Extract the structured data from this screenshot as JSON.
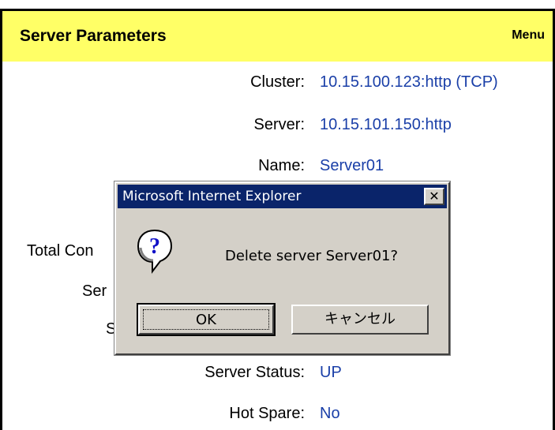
{
  "header": {
    "title": "Server Parameters",
    "menu_label": "Menu"
  },
  "fields": {
    "cluster": {
      "label": "Cluster:",
      "value": "10.15.100.123:http (TCP)"
    },
    "server": {
      "label": "Server:",
      "value": "10.15.101.150:http"
    },
    "name": {
      "label": "Name:",
      "value": "Server01"
    },
    "total_connections_partial": {
      "label": "Total Con"
    },
    "ser_partial": {
      "label": "Ser"
    },
    "s_partial": {
      "label": "S"
    },
    "server_status": {
      "label": "Server Status:",
      "value": "UP"
    },
    "hot_spare": {
      "label": "Hot Spare:",
      "value": "No"
    }
  },
  "dialog": {
    "title": "Microsoft Internet Explorer",
    "close_glyph": "✕",
    "icon": "question-icon",
    "message": "Delete server Server01?",
    "ok_label": "OK",
    "cancel_label": "キャンセル"
  },
  "colors": {
    "header_bg": "#ffff66",
    "value_text": "#1a3fa8",
    "titlebar": "#0a246a",
    "dialog_bg": "#d4d0c8"
  }
}
